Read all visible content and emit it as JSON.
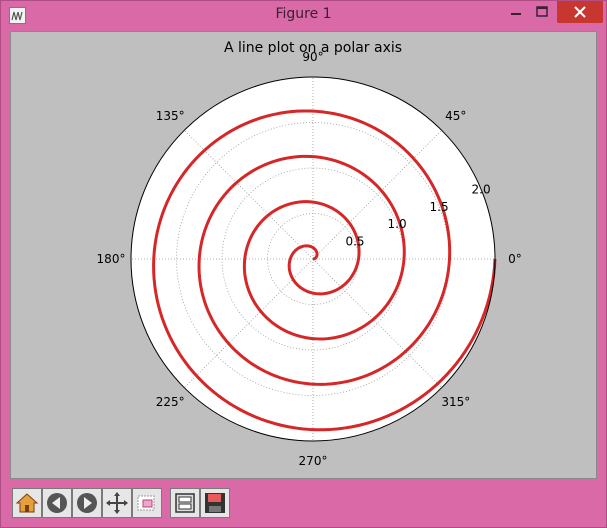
{
  "window": {
    "title": "Figure 1"
  },
  "figure": {
    "title": "A line plot on a polar axis"
  },
  "chart_data": {
    "type": "line",
    "projection": "polar",
    "title": "A line plot on a polar axis",
    "angle_ticks": [
      "0°",
      "45°",
      "90°",
      "135°",
      "180°",
      "225°",
      "270°",
      "315°"
    ],
    "radial_ticks": [
      "0.5",
      "1.0",
      "1.5",
      "2.0"
    ],
    "rlim": [
      0,
      2
    ],
    "grid": true,
    "series": [
      {
        "color": "#d62728",
        "r_equals_theta_over_2pi_times": 0.5,
        "theta_range_turns": [
          0,
          4
        ]
      }
    ]
  },
  "toolbar": {
    "items": [
      "home-icon",
      "back-icon",
      "forward-icon",
      "pan-icon",
      "zoom-icon",
      "configure-subplots-icon",
      "save-icon"
    ]
  },
  "colors": {
    "window_frame": "#d96aa7",
    "figure_bg": "#bfbfbf",
    "line": "#d62728"
  }
}
